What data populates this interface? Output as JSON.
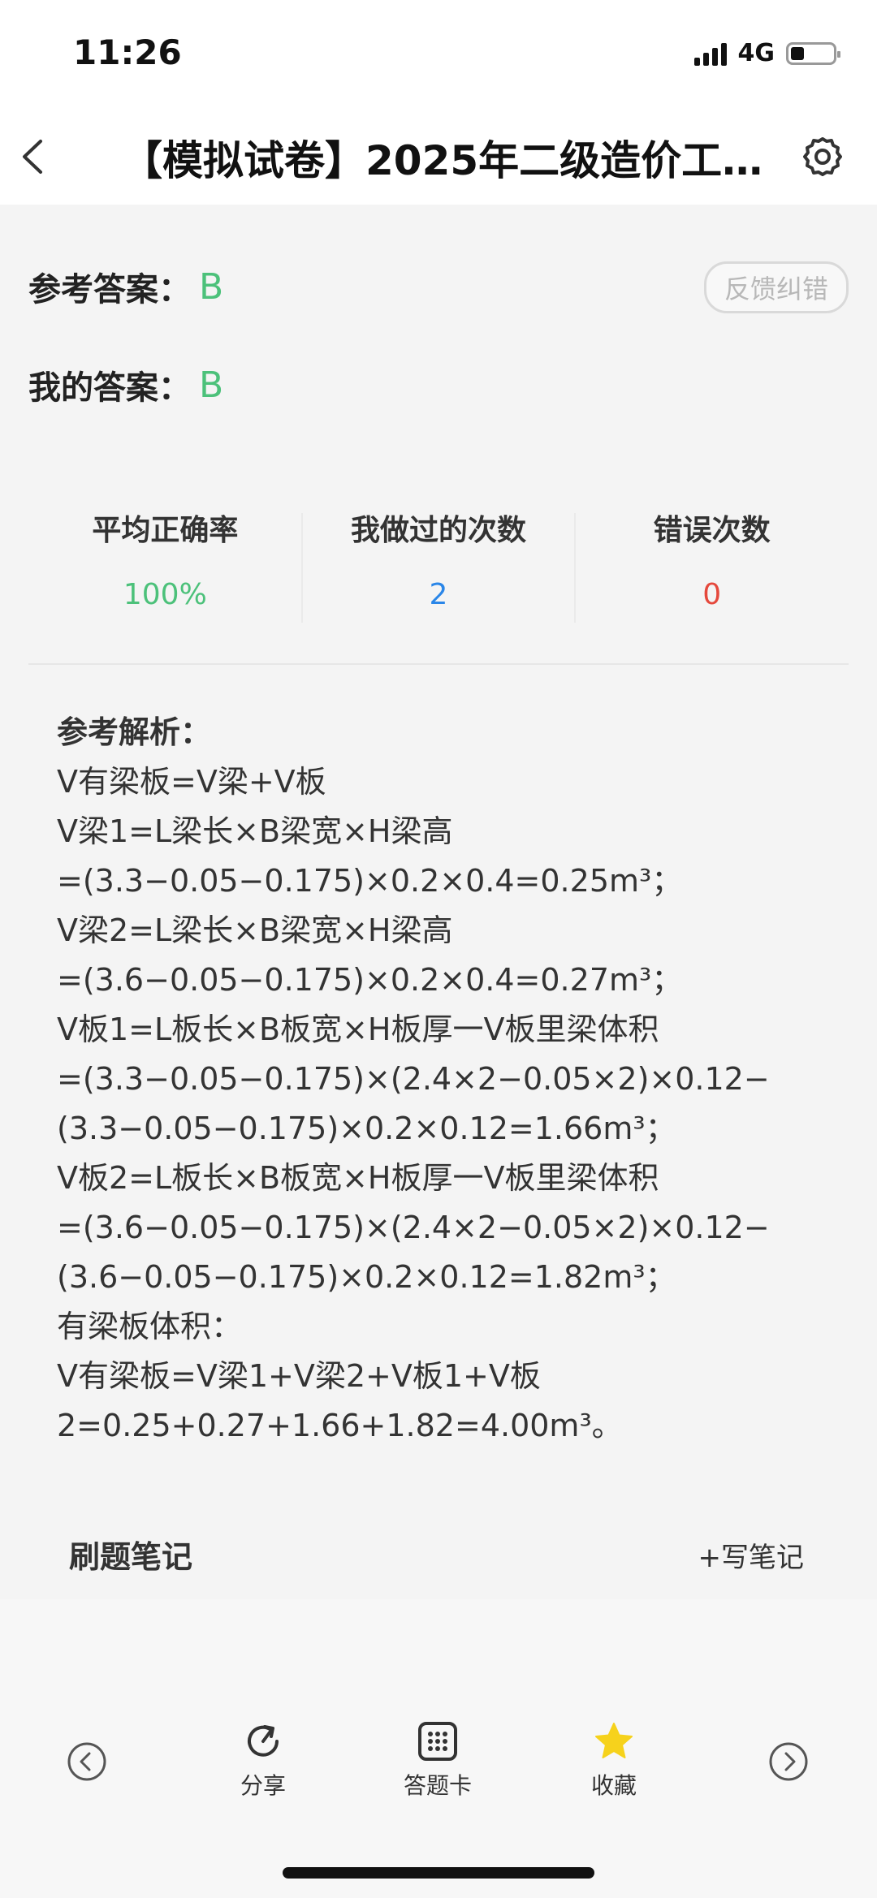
{
  "status_bar": {
    "time": "11:26",
    "network": "4G"
  },
  "nav": {
    "title": "【模拟试卷】2025年二级造价工..."
  },
  "answer": {
    "reference_label": "参考答案：",
    "reference_value": "B",
    "mine_label": "我的答案：",
    "mine_value": "B",
    "feedback_label": "反馈纠错"
  },
  "stats": [
    {
      "label": "平均正确率",
      "value": "100%",
      "color": "#4cc17a"
    },
    {
      "label": "我做过的次数",
      "value": "2",
      "color": "#2a86e8"
    },
    {
      "label": "错误次数",
      "value": "0",
      "color": "#e5483c"
    }
  ],
  "analysis": {
    "title": "参考解析：",
    "lines": [
      "V有梁板=V梁+V板",
      "V梁1=L梁长×B梁宽×H梁高",
      "=(3.3−0.05−0.175)×0.2×0.4=0.25m³；",
      "V梁2=L梁长×B梁宽×H梁高",
      "=(3.6−0.05−0.175)×0.2×0.4=0.27m³；",
      "V板1=L板长×B板宽×H板厚一V板里梁体积",
      "=(3.3−0.05−0.175)×(2.4×2−0.05×2)×0.12−",
      "(3.3−0.05−0.175)×0.2×0.12=1.66m³；",
      "V板2=L板长×B板宽×H板厚一V板里梁体积",
      "=(3.6−0.05−0.175)×(2.4×2−0.05×2)×0.12−",
      "(3.6−0.05−0.175)×0.2×0.12=1.82m³；",
      "有梁板体积：",
      "V有梁板=V梁1+V梁2+V板1+V板",
      "2=0.25+0.27+1.66+1.82=4.00m³。"
    ]
  },
  "notes": {
    "title": "刷题笔记",
    "write_label": "+写笔记"
  },
  "bottom_tabs": [
    {
      "label": "分享",
      "icon": "share-icon"
    },
    {
      "label": "答题卡",
      "icon": "answer-card-icon"
    },
    {
      "label": "收藏",
      "icon": "star-icon",
      "color": "#f6d21c"
    }
  ]
}
